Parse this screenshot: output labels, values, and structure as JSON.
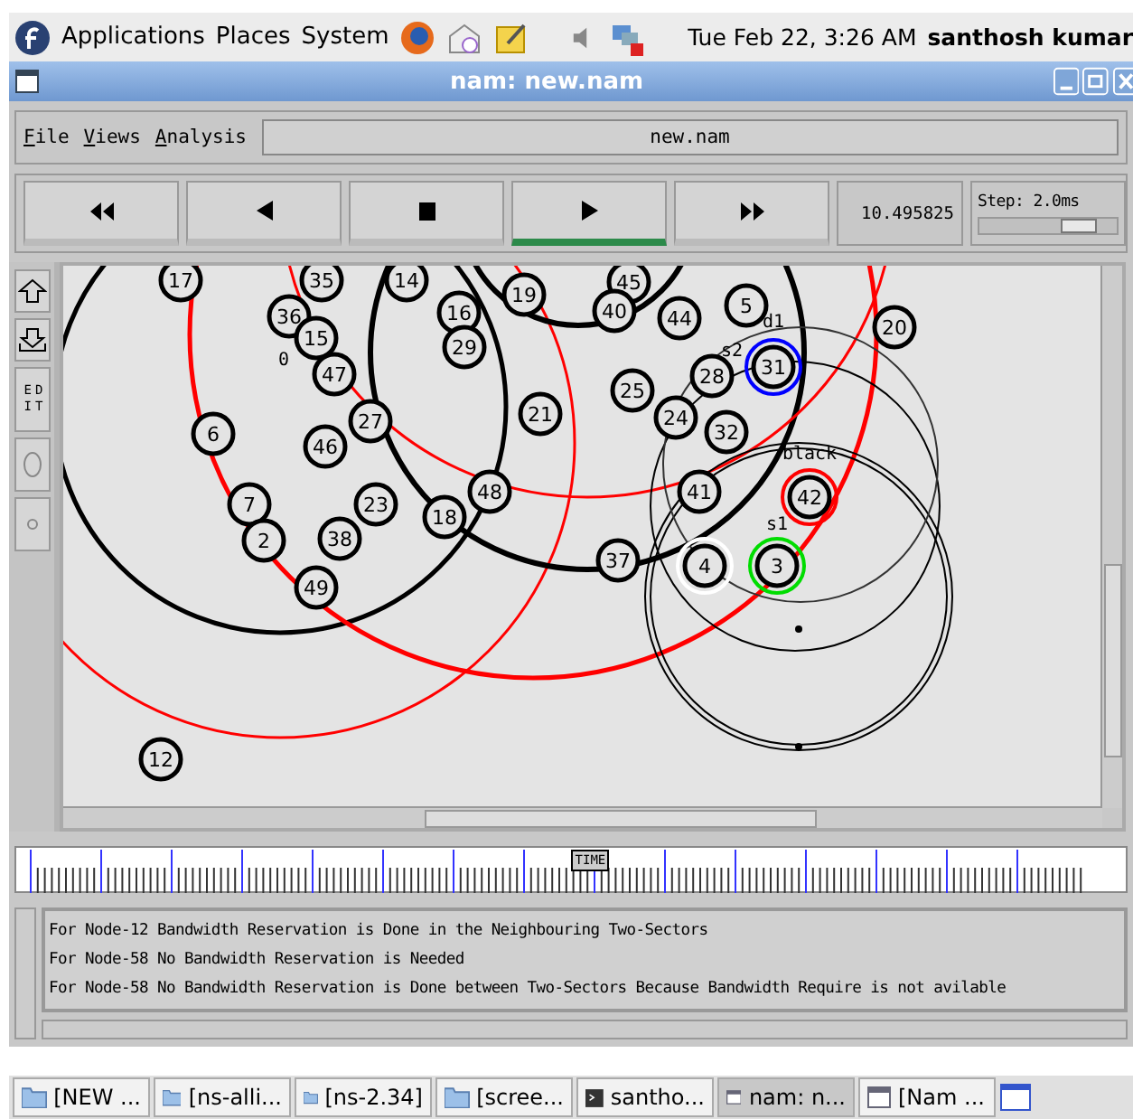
{
  "top_panel": {
    "menus": [
      "Applications",
      "Places",
      "System"
    ],
    "clock": "Tue Feb 22,  3:26 AM",
    "user": "santhosh kumar"
  },
  "window": {
    "title": "nam: new.nam"
  },
  "menubar": {
    "items": [
      "File",
      "Views",
      "Analysis"
    ],
    "file_name": "new.nam"
  },
  "controls": {
    "buttons": [
      {
        "kind": "rewind",
        "selected": false
      },
      {
        "kind": "back",
        "selected": false
      },
      {
        "kind": "stop",
        "selected": false
      },
      {
        "kind": "play",
        "selected": true
      },
      {
        "kind": "forward",
        "selected": false
      }
    ],
    "time": "10.495825",
    "step": "Step: 2.0ms",
    "step_slider": {
      "level": 0.78
    }
  },
  "side_tools": {
    "edit": "EDIT"
  },
  "nodes": [
    {
      "label": "17"
    },
    {
      "label": "35"
    },
    {
      "label": "14"
    },
    {
      "label": "19"
    },
    {
      "label": "45"
    },
    {
      "label": "36"
    },
    {
      "label": "15"
    },
    {
      "label": "47"
    },
    {
      "label": "6"
    },
    {
      "label": "27"
    },
    {
      "label": "46"
    },
    {
      "label": "7"
    },
    {
      "label": "2"
    },
    {
      "label": "23"
    },
    {
      "label": "38"
    },
    {
      "label": "18"
    },
    {
      "label": "48"
    },
    {
      "label": "49"
    },
    {
      "label": "12"
    },
    {
      "label": "16"
    },
    {
      "label": "29"
    },
    {
      "label": "21"
    },
    {
      "label": "40"
    },
    {
      "label": "44"
    },
    {
      "label": "5"
    },
    {
      "label": "20"
    },
    {
      "label": "28"
    },
    {
      "label": "31",
      "color": "#0000ff"
    },
    {
      "label": "25"
    },
    {
      "label": "24"
    },
    {
      "label": "32"
    },
    {
      "label": "41"
    },
    {
      "label": "42",
      "color": "#ff0000"
    },
    {
      "label": "37"
    },
    {
      "label": "4",
      "color": "#ffffff"
    },
    {
      "label": "3",
      "color": "#00dd00"
    }
  ],
  "node_labels": [
    "0",
    "d1",
    "s2",
    "black",
    "s1"
  ],
  "timeline": {
    "marker": "TIME",
    "level": 0.52
  },
  "log": [
    "For Node-12 Bandwidth Reservation is Done in the Neighbouring Two-Sectors",
    "For Node-58 No Bandwidth Reservation is Needed",
    "For Node-58 No Bandwidth Reservation is Done between Two-Sectors Because Bandwidth Require is not avilable"
  ],
  "taskbar": [
    {
      "label": "[NEW ...",
      "kind": "folder",
      "selected": false
    },
    {
      "label": "[ns-alli...",
      "kind": "folder",
      "selected": false
    },
    {
      "label": "[ns-2.34]",
      "kind": "folder",
      "selected": false
    },
    {
      "label": "[scree...",
      "kind": "folder",
      "selected": false
    },
    {
      "label": "santho...",
      "kind": "terminal",
      "selected": false
    },
    {
      "label": "nam: n...",
      "kind": "window",
      "selected": true
    },
    {
      "label": "[Nam ...",
      "kind": "window",
      "selected": false
    }
  ]
}
